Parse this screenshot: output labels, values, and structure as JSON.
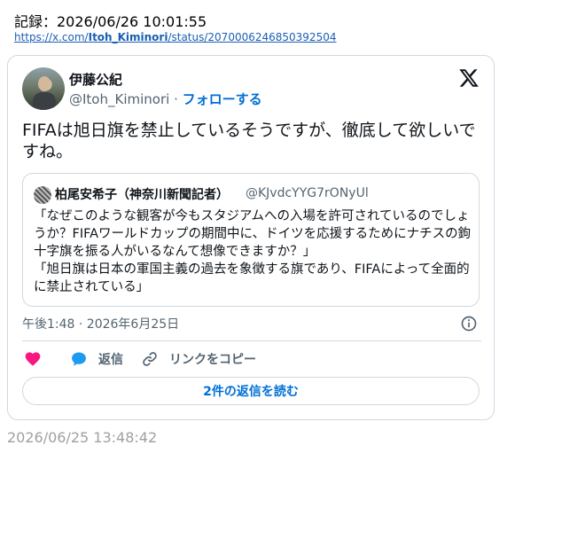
{
  "record": {
    "text": "記録：2026/06/26 10:01:55",
    "url_prefix": "https://x.com/",
    "url_user": "Itoh_Kiminori",
    "url_suffix": "/status/2070006246850392504"
  },
  "tweet": {
    "author_name": "伊藤公紀",
    "author_handle": "@Itoh_Kiminori",
    "separator": " · ",
    "follow_label": "フォローする",
    "text": "FIFAは旭日旗を禁止しているそうですが、徹底して欲しいですね。",
    "timestamp": "午後1:48 · 2026年6月25日",
    "icons": {
      "platform": "x-logo-icon",
      "info": "info-icon",
      "like": "heart-icon",
      "reply": "reply-bubble-icon",
      "copy": "link-icon"
    }
  },
  "quote": {
    "author_name": "柏尾安希子（神奈川新聞記者）",
    "author_handle": "@KJvdcYYG7rONyUl",
    "text": "「なぜこのような観客が今もスタジアムへの入場を許可されているのでしょうか？FIFAワールドカップの期間中に、ドイツを応援するためにナチスの鉤十字旗を振る人がいるなんて想像できますか？」\n「旭日旗は日本の軍国主義の過去を象徴する旗であり、FIFAによって全面的に禁止されている」"
  },
  "actions": {
    "reply_label": "返信",
    "copy_label": "リンクをコピー",
    "read_replies_label": "2件の返信を読む"
  },
  "captured_at": "2026/06/25 13:48:42",
  "colors": {
    "accent": "#006fd6",
    "like": "#f91880",
    "reply": "#1d9bf0",
    "muted": "#536471",
    "border": "#cfd9de"
  }
}
